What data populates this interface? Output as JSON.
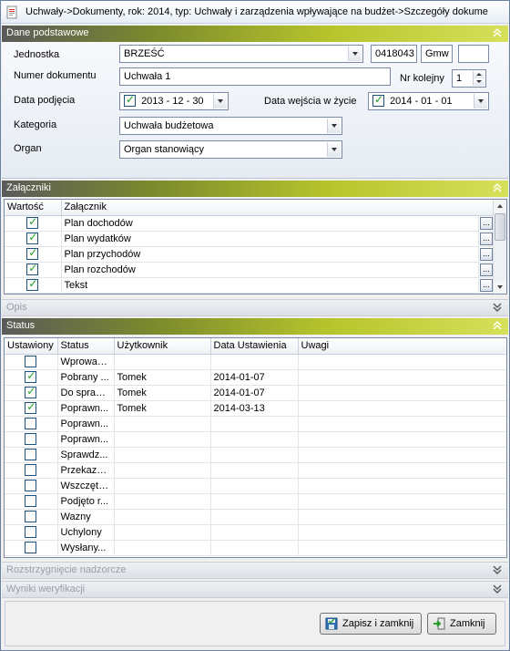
{
  "window": {
    "title": "Uchwały->Dokumenty, rok: 2014, typ: Uchwały i zarządzenia wpływające na budżet->Szczegóły dokume"
  },
  "panels": {
    "dane": {
      "title": "Dane podstawowe"
    },
    "zalaczniki": {
      "title": "Załączniki"
    },
    "opis": {
      "title": "Opis"
    },
    "status": {
      "title": "Status"
    },
    "rozstrzygniecie": {
      "title": "Rozstrzygnięcie nadzorcze"
    },
    "wyniki": {
      "title": "Wyniki weryfikacji"
    }
  },
  "form": {
    "jednostka_label": "Jednostka",
    "jednostka_value": "BRZEŚĆ",
    "jednostka_code": "0418043",
    "jednostka_type": "Gmw",
    "jednostka_extra": "",
    "numer_label": "Numer dokumentu",
    "numer_value": "Uchwała 1",
    "nr_kolejny_label": "Nr kolejny",
    "nr_kolejny_value": "1",
    "data_podjecia_label": "Data podjęcia",
    "data_podjecia_value": "2013 - 12 - 30",
    "data_wejscia_label": "Data wejścia w życie",
    "data_wejscia_value": "2014 - 01 - 01",
    "kategoria_label": "Kategoria",
    "kategoria_value": "Uchwała budżetowa",
    "organ_label": "Organ",
    "organ_value": "Organ stanowiący"
  },
  "attachments": {
    "columns": [
      "Wartość",
      "Załącznik"
    ],
    "rows": [
      {
        "checked": true,
        "name": "Plan dochodów"
      },
      {
        "checked": true,
        "name": "Plan wydatków"
      },
      {
        "checked": true,
        "name": "Plan przychodów"
      },
      {
        "checked": true,
        "name": "Plan rozchodów"
      },
      {
        "checked": true,
        "name": "Tekst"
      }
    ],
    "button_label": "..."
  },
  "status_grid": {
    "columns": [
      "Ustawiony",
      "Status",
      "Użytkownik",
      "Data Ustawienia",
      "Uwagi"
    ],
    "rows": [
      {
        "checked": false,
        "status": "Wprowad...",
        "user": "",
        "date": "",
        "notes": ""
      },
      {
        "checked": true,
        "status": "Pobrany ...",
        "user": "Tomek",
        "date": "2014-01-07",
        "notes": ""
      },
      {
        "checked": true,
        "status": "Do spraw...",
        "user": "Tomek",
        "date": "2014-01-07",
        "notes": ""
      },
      {
        "checked": true,
        "status": "Poprawn...",
        "user": "Tomek",
        "date": "2014-03-13",
        "notes": ""
      },
      {
        "checked": false,
        "status": "Poprawn...",
        "user": "",
        "date": "",
        "notes": ""
      },
      {
        "checked": false,
        "status": "Poprawn...",
        "user": "",
        "date": "",
        "notes": ""
      },
      {
        "checked": false,
        "status": "Sprawdz...",
        "user": "",
        "date": "",
        "notes": ""
      },
      {
        "checked": false,
        "status": "Przekaza...",
        "user": "",
        "date": "",
        "notes": ""
      },
      {
        "checked": false,
        "status": "Wszczęto...",
        "user": "",
        "date": "",
        "notes": ""
      },
      {
        "checked": false,
        "status": "Podjęto r...",
        "user": "",
        "date": "",
        "notes": ""
      },
      {
        "checked": false,
        "status": "Wazny",
        "user": "",
        "date": "",
        "notes": ""
      },
      {
        "checked": false,
        "status": "Uchylony",
        "user": "",
        "date": "",
        "notes": ""
      },
      {
        "checked": false,
        "status": "Wysłany...",
        "user": "",
        "date": "",
        "notes": ""
      }
    ]
  },
  "buttons": {
    "save_close": "Zapisz i zamknij",
    "close": "Zamknij"
  },
  "colors": {
    "header_accent": "#b7c52c",
    "check_green": "#21a121",
    "border_blue": "#7a8aa6"
  }
}
